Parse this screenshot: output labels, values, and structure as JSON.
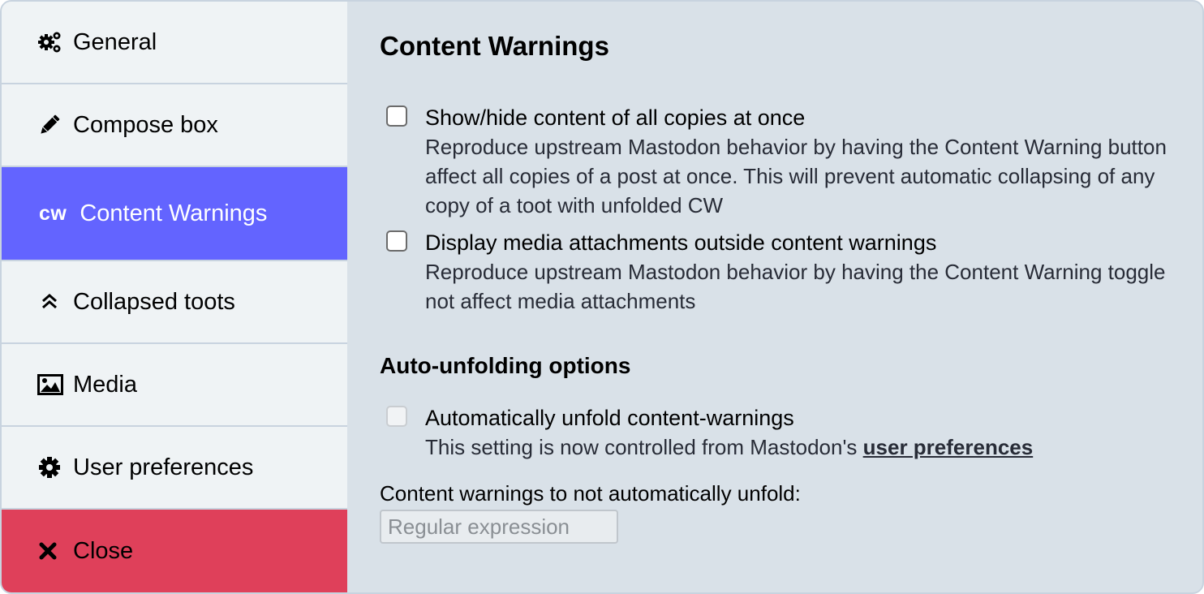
{
  "sidebar": {
    "items": [
      {
        "label": "General",
        "icon": "gears-icon"
      },
      {
        "label": "Compose box",
        "icon": "pencil-icon"
      },
      {
        "label": "Content Warnings",
        "icon": "cw-icon",
        "badge": "cw",
        "active": true
      },
      {
        "label": "Collapsed toots",
        "icon": "angle-double-up-icon"
      },
      {
        "label": "Media",
        "icon": "image-icon"
      },
      {
        "label": "User preferences",
        "icon": "cog-icon"
      },
      {
        "label": "Close",
        "icon": "close-icon"
      }
    ]
  },
  "main": {
    "title": "Content Warnings",
    "options": [
      {
        "label": "Show/hide content of all copies at once",
        "description": "Reproduce upstream Mastodon behavior by having the Content Warning button affect all copies of a post at once. This will prevent automatic collapsing of any copy of a toot with unfolded CW",
        "checked": false
      },
      {
        "label": "Display media attachments outside content warnings",
        "description": "Reproduce upstream Mastodon behavior by having the Content Warning toggle not affect media attachments",
        "checked": false
      }
    ],
    "auto_unfold": {
      "heading": "Auto-unfolding options",
      "option_label": "Automatically unfold content-warnings",
      "option_desc_prefix": "This setting is now controlled from Mastodon's ",
      "option_desc_link": "user preferences",
      "disabled": true,
      "field_label": "Content warnings to not automatically unfold:",
      "field_placeholder": "Regular expression",
      "field_value": ""
    }
  },
  "colors": {
    "active": "#6364ff",
    "close": "#df405a",
    "sidebar_bg": "#eff3f5",
    "main_bg": "#d9e1e8"
  }
}
